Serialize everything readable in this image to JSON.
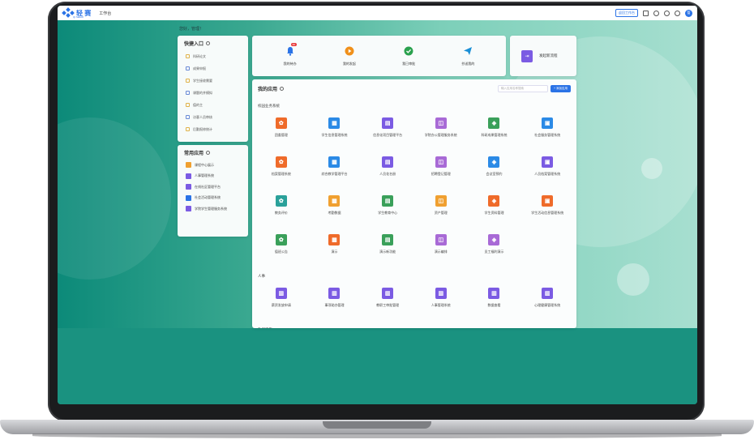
{
  "header": {
    "logo_text": "轻 赛",
    "logo_sub": "Qi Saisoft",
    "workspace_label": "工作台",
    "back_button": "返回工作台",
    "avatar_text": "管"
  },
  "greeting": "您好，管理！",
  "quick_links": {
    "title": "快捷入口",
    "items": [
      {
        "label": "科研论文"
      },
      {
        "label": "成果申报"
      },
      {
        "label": "学生接收需要"
      },
      {
        "label": "课题的并模拟"
      },
      {
        "label": "值的主"
      },
      {
        "label": "访客人员审核"
      },
      {
        "label": "后勤报修统计"
      }
    ]
  },
  "common_apps": {
    "title": "常用应用",
    "items": [
      {
        "label": "课程中心展示",
        "color": "#f0a030"
      },
      {
        "label": "人事管理系统",
        "color": "#7b5be3"
      },
      {
        "label": "在线社区管理平台",
        "color": "#7b5be3"
      },
      {
        "label": "社会活动管理系统",
        "color": "#2b73e6"
      },
      {
        "label": "学院学生管理服务系统",
        "color": "#7b5be3"
      }
    ]
  },
  "summary": {
    "items": [
      {
        "label": "我的待办",
        "icon": "bell-icon",
        "color": "#2b73e6",
        "badge": "99"
      },
      {
        "label": "我的发起",
        "icon": "play-icon",
        "color": "#f0901a"
      },
      {
        "label": "我已审批",
        "icon": "check-icon",
        "color": "#2aa14e"
      },
      {
        "label": "抄送我的",
        "icon": "send-icon",
        "color": "#1a8fd6"
      }
    ],
    "new_process": "发起新流程"
  },
  "apps": {
    "title": "我的应用",
    "search_placeholder": "输入应用名称搜索",
    "add_button": "+ 添加应用",
    "categories": [
      {
        "name": "校园业务系统",
        "items": [
          {
            "label": "团委管理",
            "color": "#ef6b2a"
          },
          {
            "label": "学生信息管理系统",
            "color": "#2b8ae6"
          },
          {
            "label": "信息化项目管理平台",
            "color": "#7b5be3"
          },
          {
            "label": "学院办公管理服务系统",
            "color": "#a86ad6"
          },
          {
            "label": "科研成果管理系统",
            "color": "#3aa05a"
          },
          {
            "label": "社会服务管理系统",
            "color": "#2b8ae6"
          },
          {
            "label": "档案管理系统",
            "color": "#ef6b2a"
          },
          {
            "label": "综合教学管理平台",
            "color": "#2b8ae6"
          },
          {
            "label": "人员花名册",
            "color": "#7b5be3"
          },
          {
            "label": "招聘登记管理",
            "color": "#a86ad6"
          },
          {
            "label": "会议室预约",
            "color": "#2b8ae6"
          },
          {
            "label": "人员档案管理系统",
            "color": "#7b5be3"
          },
          {
            "label": "教务评价",
            "color": "#2aa19a"
          },
          {
            "label": "考勤数据",
            "color": "#f0a030"
          },
          {
            "label": "学生教育中心",
            "color": "#3aa05a"
          },
          {
            "label": "资产管理",
            "color": "#f0a030"
          },
          {
            "label": "学生资料管理",
            "color": "#ef6b2a"
          },
          {
            "label": "学生活动信息管理系统",
            "color": "#ef6b2a"
          },
          {
            "label": "值班公告",
            "color": "#3aa05a"
          },
          {
            "label": "演示",
            "color": "#ef6b2a"
          },
          {
            "label": "演示新功能",
            "color": "#3aa05a"
          },
          {
            "label": "演示编排",
            "color": "#a86ad6"
          },
          {
            "label": "员工福利演示",
            "color": "#a86ad6"
          }
        ]
      },
      {
        "name": "人事",
        "items": [
          {
            "label": "薪资发放申请",
            "color": "#7b5be3"
          },
          {
            "label": "事项助办管理",
            "color": "#7b5be3"
          },
          {
            "label": "教职工审批管理",
            "color": "#7b5be3"
          },
          {
            "label": "人事管理系统",
            "color": "#7b5be3"
          },
          {
            "label": "数据查看",
            "color": "#7b5be3"
          },
          {
            "label": "心理健康管理系统",
            "color": "#7b5be3"
          }
        ]
      },
      {
        "name": "数据采集",
        "items": []
      }
    ]
  }
}
